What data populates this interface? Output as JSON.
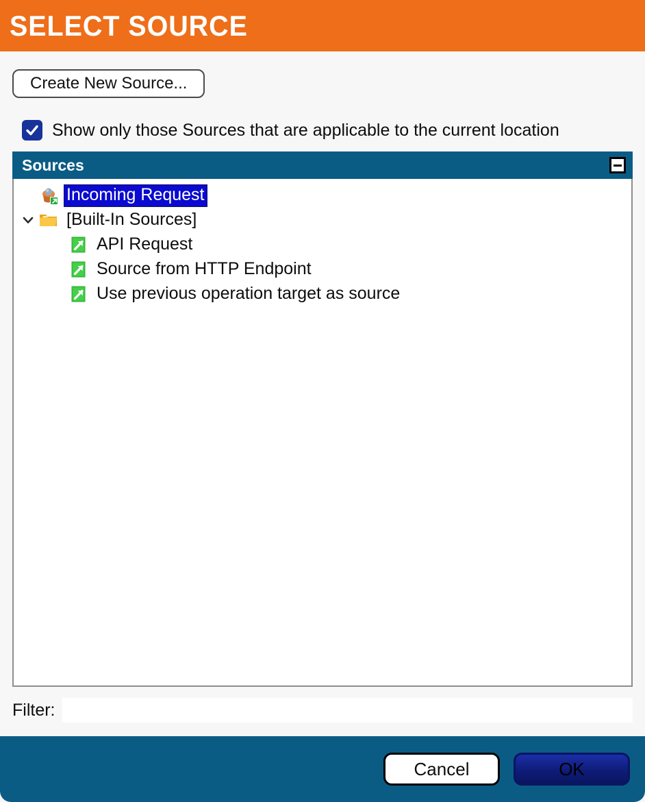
{
  "window": {
    "title": "SELECT SOURCE",
    "accent_orange": "#ee6e1a",
    "accent_teal": "#0b5c85",
    "selection_blue": "#0a0ad0"
  },
  "toolbar": {
    "create_label": "Create New Source..."
  },
  "options": {
    "show_applicable_label": "Show only those Sources that are applicable to the current location",
    "show_applicable_checked": true,
    "checkmark_icon": "check-icon"
  },
  "sources_group": {
    "header_label": "Sources",
    "collapse_icon": "minus-icon"
  },
  "tree": {
    "nodes": [
      {
        "label": "Incoming Request",
        "icon": "source-basket-icon",
        "indent": 1,
        "selected": true,
        "twisty": "none"
      },
      {
        "label": "[Built-In Sources]",
        "icon": "folder-icon",
        "indent": 1,
        "selected": false,
        "twisty": "expanded"
      },
      {
        "label": "API Request",
        "icon": "shortcut-icon",
        "indent": 2,
        "selected": false,
        "twisty": "none"
      },
      {
        "label": "Source from HTTP Endpoint",
        "icon": "shortcut-icon",
        "indent": 2,
        "selected": false,
        "twisty": "none"
      },
      {
        "label": "Use previous operation target as source",
        "icon": "shortcut-icon",
        "indent": 2,
        "selected": false,
        "twisty": "none"
      }
    ]
  },
  "filter": {
    "label": "Filter:",
    "value": "",
    "placeholder": ""
  },
  "footer": {
    "cancel_label": "Cancel",
    "ok_label": "OK"
  }
}
